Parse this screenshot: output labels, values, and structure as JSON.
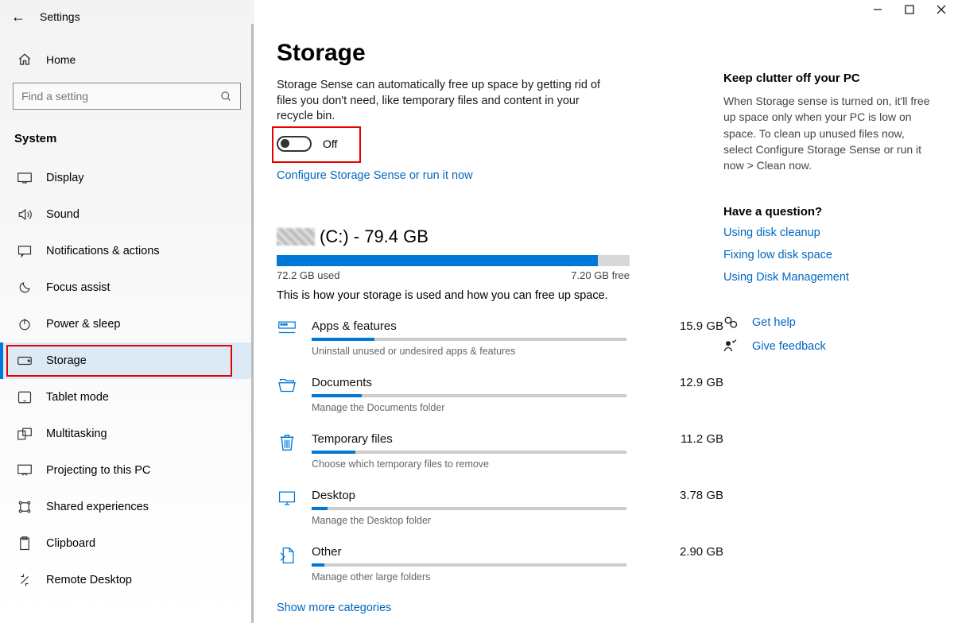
{
  "app_title": "Settings",
  "home_label": "Home",
  "search_placeholder": "Find a setting",
  "section_header": "System",
  "nav": [
    {
      "key": "display",
      "label": "Display"
    },
    {
      "key": "sound",
      "label": "Sound"
    },
    {
      "key": "notifications",
      "label": "Notifications & actions"
    },
    {
      "key": "focus",
      "label": "Focus assist"
    },
    {
      "key": "power",
      "label": "Power & sleep"
    },
    {
      "key": "storage",
      "label": "Storage",
      "selected": true
    },
    {
      "key": "tablet",
      "label": "Tablet mode"
    },
    {
      "key": "multitask",
      "label": "Multitasking"
    },
    {
      "key": "projecting",
      "label": "Projecting to this PC"
    },
    {
      "key": "shared",
      "label": "Shared experiences"
    },
    {
      "key": "clipboard",
      "label": "Clipboard"
    },
    {
      "key": "remote",
      "label": "Remote Desktop"
    }
  ],
  "page_title": "Storage",
  "sense_desc": "Storage Sense can automatically free up space by getting rid of files you don't need, like temporary files and content in your recycle bin.",
  "toggle_label": "Off",
  "configure_link": "Configure Storage Sense or run it now",
  "drive": {
    "label_suffix": "(C:) - 79.4 GB",
    "used_label": "72.2 GB used",
    "free_label": "7.20 GB free",
    "used_pct": 91,
    "note": "This is how your storage is used and how you can free up space."
  },
  "categories": [
    {
      "name": "Apps & features",
      "size": "15.9 GB",
      "pct": 20,
      "sub": "Uninstall unused or undesired apps & features"
    },
    {
      "name": "Documents",
      "size": "12.9 GB",
      "pct": 16,
      "sub": "Manage the Documents folder"
    },
    {
      "name": "Temporary files",
      "size": "11.2 GB",
      "pct": 14,
      "sub": "Choose which temporary files to remove"
    },
    {
      "name": "Desktop",
      "size": "3.78 GB",
      "pct": 5,
      "sub": "Manage the Desktop folder"
    },
    {
      "name": "Other",
      "size": "2.90 GB",
      "pct": 4,
      "sub": "Manage other large folders"
    }
  ],
  "show_more": "Show more categories",
  "right": {
    "h1": "Keep clutter off your PC",
    "p1": "When Storage sense is turned on, it'll free up space only when your PC is low on space. To clean up unused files now, select Configure Storage Sense or run it now > Clean now.",
    "h2": "Have a question?",
    "links": [
      "Using disk cleanup",
      "Fixing low disk space",
      "Using Disk Management"
    ],
    "get_help": "Get help",
    "give_feedback": "Give feedback"
  }
}
